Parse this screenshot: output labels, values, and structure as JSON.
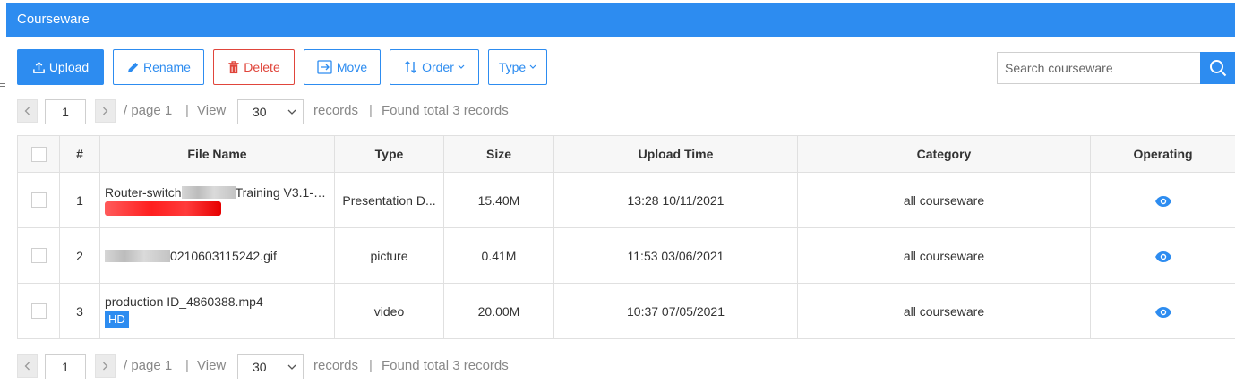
{
  "header": {
    "title": "Courseware"
  },
  "toolbar": {
    "upload_label": "Upload",
    "rename_label": "Rename",
    "delete_label": "Delete",
    "move_label": "Move",
    "order_label": "Order",
    "type_label": "Type",
    "search_placeholder": "Search courseware"
  },
  "pagination": {
    "current_page": "1",
    "page_text": "/ page 1",
    "view_label": "View",
    "per_page": "30",
    "records_label": "records",
    "found_text": "Found total 3 records",
    "separator": "|"
  },
  "table": {
    "columns": {
      "index": "#",
      "file_name": "File Name",
      "type": "Type",
      "size": "Size",
      "upload_time": "Upload Time",
      "category": "Category",
      "operating": "Operating"
    },
    "rows": [
      {
        "index": "1",
        "name_prefix": "Router-switch",
        "name_suffix": "Training V3.1-2...",
        "type": "Presentation D...",
        "size": "15.40M",
        "upload_time": "13:28 10/11/2021",
        "category": "all courseware"
      },
      {
        "index": "2",
        "name_prefix": "",
        "name_suffix": "0210603115242.gif",
        "type": "picture",
        "size": "0.41M",
        "upload_time": "11:53 03/06/2021",
        "category": "all courseware"
      },
      {
        "index": "3",
        "name_prefix": "production ID_4860388.mp4",
        "name_suffix": "",
        "badge": "HD",
        "type": "video",
        "size": "20.00M",
        "upload_time": "10:37 07/05/2021",
        "category": "all courseware"
      }
    ]
  },
  "colors": {
    "primary": "#2d8cf0",
    "danger": "#e0453b",
    "header_bg": "#2d8cf0"
  },
  "icons": [
    "upload-icon",
    "pencil-icon",
    "trash-icon",
    "move-icon",
    "sort-icon",
    "chevron-down-icon",
    "search-icon",
    "chevron-left-icon",
    "chevron-right-icon",
    "eye-icon"
  ]
}
